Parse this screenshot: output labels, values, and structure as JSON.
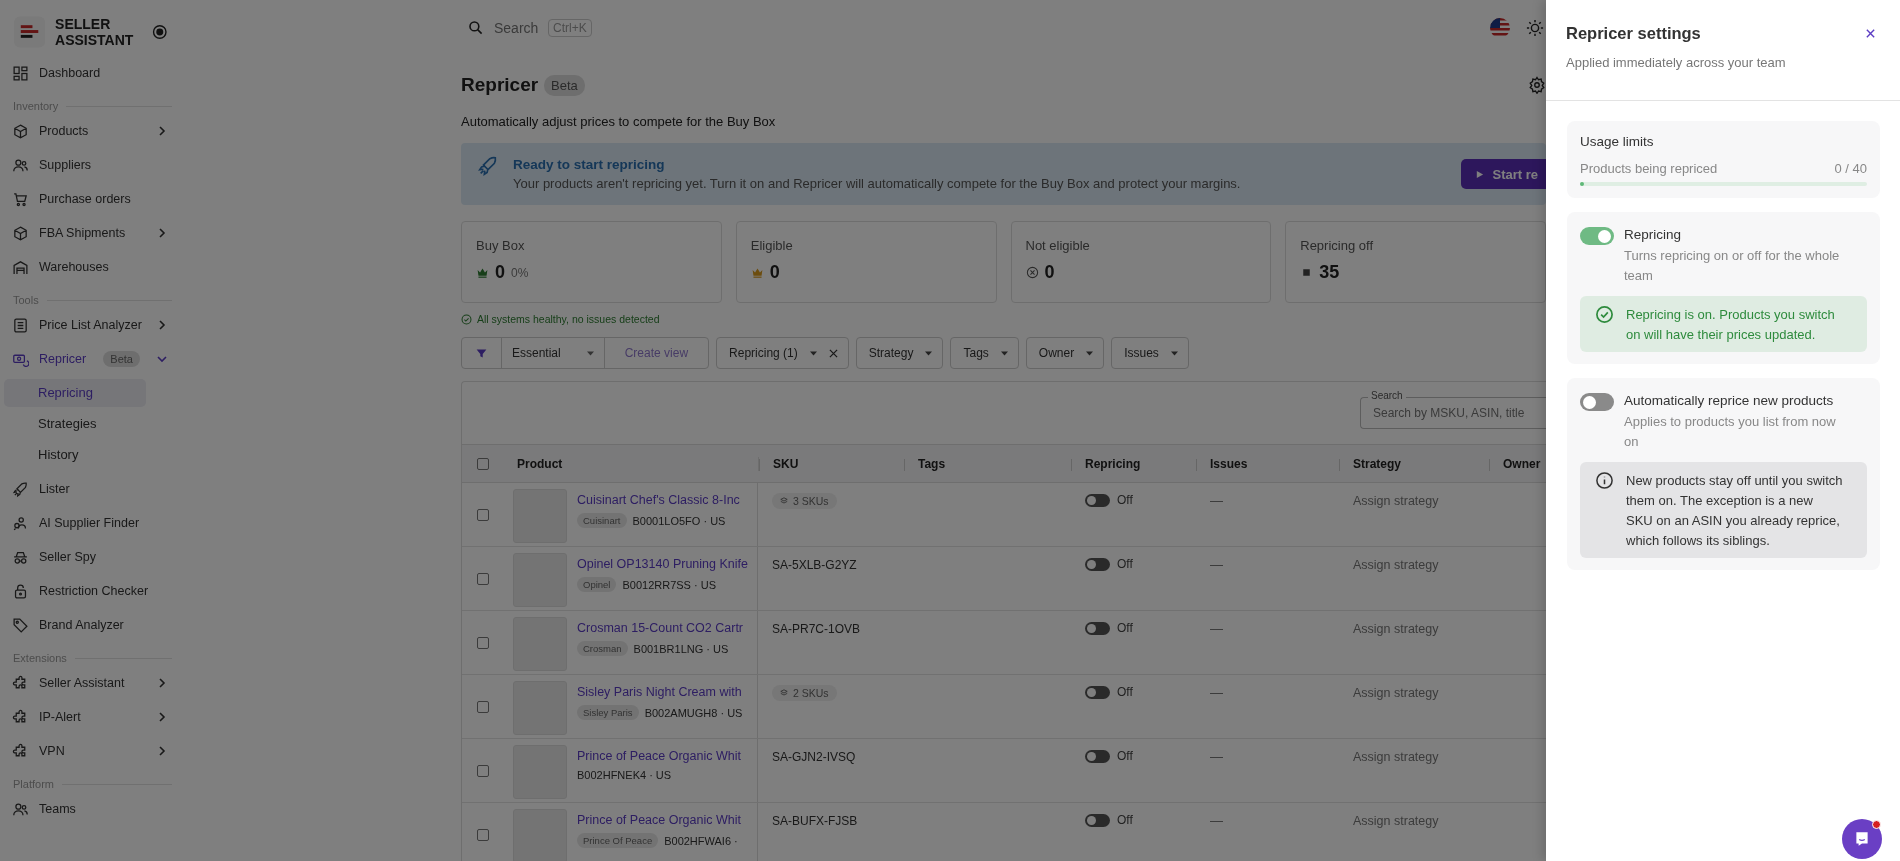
{
  "sidebar": {
    "brand": "SELLER ASSISTANT",
    "groups": [
      {
        "items": [
          {
            "label": "Dashboard",
            "kind": "link",
            "selected": false
          }
        ]
      },
      {
        "label": "Inventory",
        "items": [
          {
            "label": "Products",
            "kind": "group",
            "expanded": false,
            "selected": false
          },
          {
            "label": "Suppliers",
            "kind": "link",
            "selected": false
          },
          {
            "label": "Purchase orders",
            "kind": "link",
            "selected": false
          },
          {
            "label": "FBA Shipments",
            "kind": "group",
            "expanded": false,
            "selected": false
          },
          {
            "label": "Warehouses",
            "kind": "link",
            "selected": false
          }
        ]
      },
      {
        "label": "Tools",
        "items": [
          {
            "label": "Price List Analyzer",
            "kind": "group",
            "expanded": false,
            "selected": false
          },
          {
            "label": "Repricer",
            "kind": "group",
            "expanded": true,
            "selected": true,
            "badge": "Beta",
            "children": [
              {
                "label": "Repricing",
                "selected": true
              },
              {
                "label": "Strategies",
                "selected": false
              },
              {
                "label": "History",
                "selected": false
              }
            ]
          },
          {
            "label": "Lister",
            "kind": "link",
            "selected": false
          },
          {
            "label": "AI Supplier Finder",
            "kind": "link",
            "selected": false
          },
          {
            "label": "Seller Spy",
            "kind": "link",
            "selected": false
          },
          {
            "label": "Restriction Checker",
            "kind": "link",
            "selected": false
          },
          {
            "label": "Brand Analyzer",
            "kind": "link",
            "selected": false
          }
        ]
      },
      {
        "label": "Extensions",
        "items": [
          {
            "label": "Seller Assistant",
            "kind": "group",
            "expanded": false,
            "selected": false
          },
          {
            "label": "IP-Alert",
            "kind": "group",
            "expanded": false,
            "selected": false
          },
          {
            "label": "VPN",
            "kind": "group",
            "expanded": false,
            "selected": false
          }
        ]
      },
      {
        "label": "Platform",
        "items": [
          {
            "label": "Teams",
            "kind": "link",
            "selected": false
          }
        ]
      }
    ]
  },
  "topbar": {
    "search": {
      "placeholder": "Search",
      "shortcut": "Ctrl+K"
    }
  },
  "page": {
    "title": "Repricer",
    "badge": "Beta",
    "subtitle": "Automatically adjust prices to compete for the Buy Box",
    "banner": {
      "title": "Ready to start repricing",
      "text": "Your products aren't repricing yet. Turn it on and Repricer will automatically compete for the Buy Box and protect your margins.",
      "button": "Start re"
    },
    "stats": [
      {
        "kind": "buybox",
        "label": "Buy Box",
        "value": "0",
        "extra": "0%"
      },
      {
        "kind": "eligible",
        "label": "Eligible",
        "value": "0"
      },
      {
        "kind": "not_eligible",
        "label": "Not eligible",
        "value": "0"
      },
      {
        "kind": "off",
        "label": "Repricing off",
        "value": "35"
      }
    ],
    "health": "All systems healthy, no issues detected",
    "filters": {
      "view": "Essential",
      "create_view": "Create view",
      "chips": [
        {
          "label": "Repricing (1)",
          "removable": true
        },
        {
          "label": "Strategy",
          "removable": false
        },
        {
          "label": "Tags",
          "removable": false
        },
        {
          "label": "Owner",
          "removable": false
        },
        {
          "label": "Issues",
          "removable": false
        }
      ]
    },
    "table": {
      "search": {
        "label": "Search",
        "placeholder": "Search by MSKU, ASIN, title"
      },
      "select_all_checked": false,
      "columns": [
        "Product",
        "SKU",
        "Tags",
        "Repricing",
        "Issues",
        "Strategy",
        "Owner"
      ],
      "rows": [
        {
          "checked": false,
          "name": "Cuisinart Chef's Classic 8-Inc",
          "brand": "Cuisinart",
          "id": "B0001LO5FO · US",
          "sku_count": "3 SKUs",
          "repricing_on": false,
          "repricing": "Off",
          "issues": "—",
          "strategy": "Assign strategy"
        },
        {
          "checked": false,
          "name": "Opinel OP13140 Pruning Knife",
          "brand": "Opinel",
          "id": "B0012RR7SS · US",
          "sku": "SA-5XLB-G2YZ",
          "repricing_on": false,
          "repricing": "Off",
          "issues": "—",
          "strategy": "Assign strategy"
        },
        {
          "checked": false,
          "name": "Crosman 15-Count CO2 Cartr",
          "brand": "Crosman",
          "id": "B001BR1LNG · US",
          "sku": "SA-PR7C-1OVB",
          "repricing_on": false,
          "repricing": "Off",
          "issues": "—",
          "strategy": "Assign strategy"
        },
        {
          "checked": false,
          "name": "Sisley Paris Night Cream with",
          "brand": "Sisley Paris",
          "id": "B002AMUGH8 · US",
          "sku_count": "2 SKUs",
          "repricing_on": false,
          "repricing": "Off",
          "issues": "—",
          "strategy": "Assign strategy"
        },
        {
          "checked": false,
          "name": "Prince of Peace Organic Whit",
          "id": "B002HFNEK4 · US",
          "sku": "SA-GJN2-IVSQ",
          "repricing_on": false,
          "repricing": "Off",
          "issues": "—",
          "strategy": "Assign strategy"
        },
        {
          "checked": false,
          "name": "Prince of Peace Organic Whit",
          "brand": "Prince Of Peace",
          "id": "B002HFWAI6 ·",
          "sku": "SA-BUFX-FJSB",
          "repricing_on": false,
          "repricing": "Off",
          "issues": "—",
          "strategy": "Assign strategy"
        }
      ]
    }
  },
  "drawer": {
    "title": "Repricer settings",
    "subtitle": "Applied immediately across your team",
    "usage": {
      "title": "Usage limits",
      "label": "Products being repriced",
      "reading": "0 / 40",
      "level": 0
    },
    "settings": [
      {
        "title": "Repricing",
        "description": "Turns repricing on or off for the whole team",
        "on": true,
        "notice": {
          "kind": "success",
          "text": "Repricing is on. Products you switch on will have their prices updated."
        }
      },
      {
        "title": "Automatically reprice new products",
        "description": "Applies to products you list from now on",
        "on": false,
        "notice": {
          "kind": "info",
          "text": "New products stay off until you switch them on. The exception is a new SKU on an ASIN you already reprice, which follows its siblings."
        }
      }
    ]
  }
}
